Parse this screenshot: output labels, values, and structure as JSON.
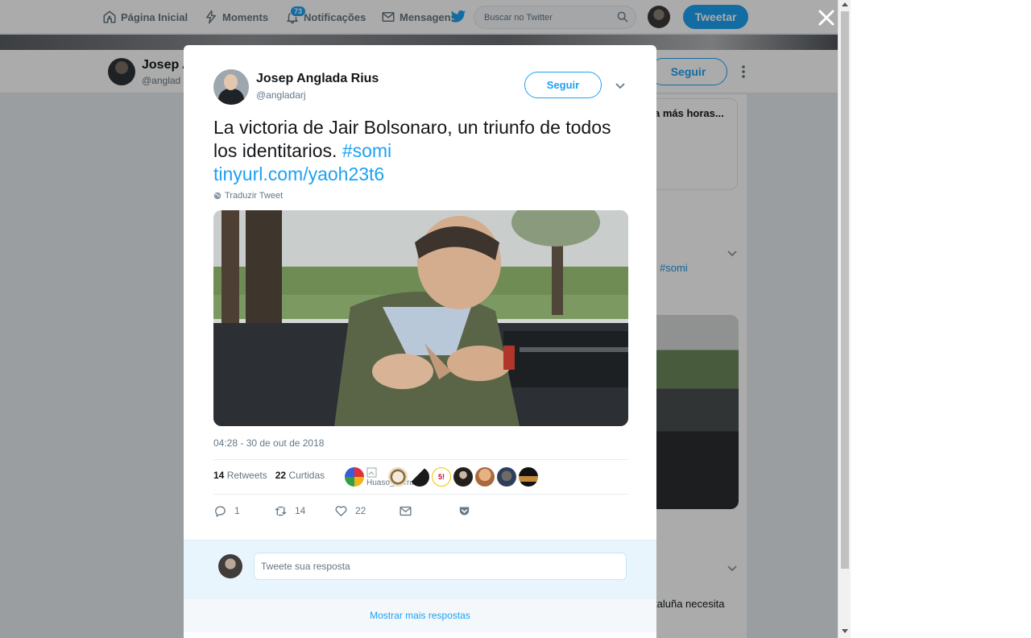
{
  "nav": {
    "home_label": "Página Inicial",
    "moments_label": "Moments",
    "notifications_label": "Notificações",
    "notifications_count": "73",
    "messages_label": "Mensagens",
    "search_placeholder": "Buscar no Twitter",
    "tweet_button": "Tweetar"
  },
  "profile_bar": {
    "name": "Josep A",
    "handle": "@anglad",
    "follow_label": "Seguir"
  },
  "background": {
    "card_text": "a más horas...",
    "hashtag": "#somi",
    "snippet": "taluña necesita"
  },
  "tweet": {
    "author_name": "Josep Anglada Rius",
    "author_handle": "@angladarj",
    "follow_label": "Seguir",
    "text_plain": "La victoria de Jair Bolsonaro, un triunfo de todos los identitarios.",
    "hashtag": "#somi",
    "link": "tinyurl.com/yaoh23t6",
    "translate_label": "Traduzir Tweet",
    "timestamp": "04:28 - 30 de out de 2018",
    "retweets_count": "14",
    "retweets_label": "Retweets",
    "likes_count": "22",
    "likes_label": "Curtidas",
    "broken_liker_alt": "Huaso_Korro",
    "liker_badge": "5!",
    "actions": {
      "replies": "1",
      "retweets": "14",
      "likes": "22"
    }
  },
  "reply": {
    "placeholder": "Tweete sua resposta"
  },
  "more_replies": "Mostrar mais respostas",
  "colors": {
    "accent": "#1da1f2",
    "secondary_text": "#657786",
    "overlay": "rgba(0,0,0,0.33)"
  }
}
